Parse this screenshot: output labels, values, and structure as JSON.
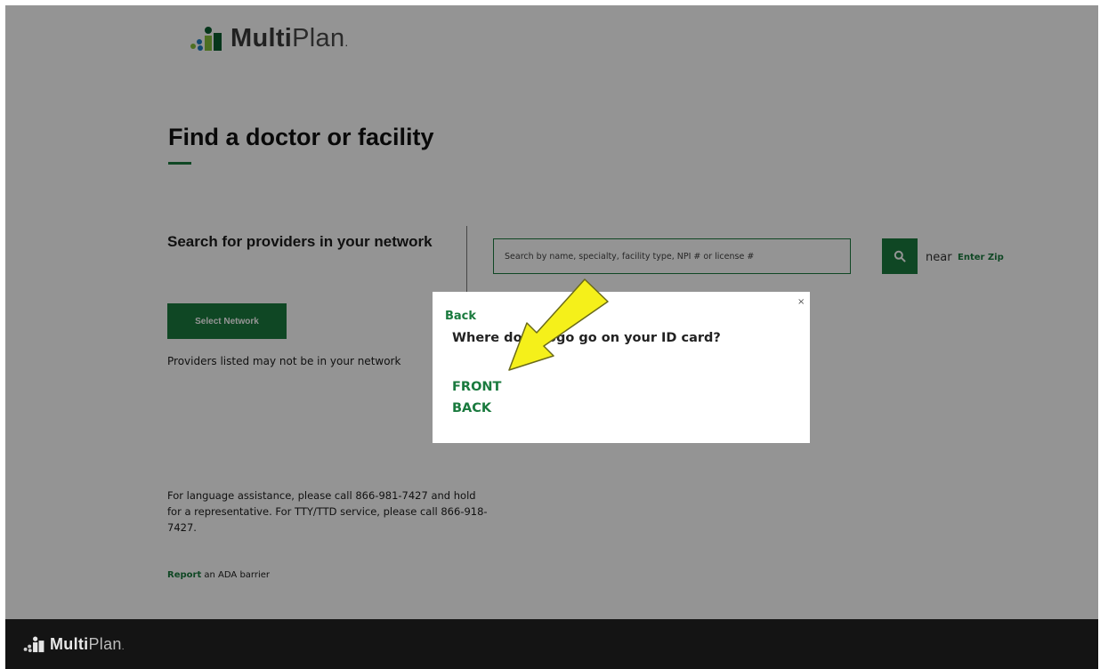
{
  "header": {
    "logo": {
      "word_bold": "Multi",
      "word_light": "Plan",
      "suffix": "."
    }
  },
  "page": {
    "title": "Find a doctor or facility"
  },
  "network": {
    "heading": "Search for providers in your network",
    "select_button": "Select Network",
    "note": "Providers listed may not be in your network"
  },
  "search": {
    "placeholder": "Search by name, specialty, facility type, NPI # or license #",
    "button_icon": "search-icon",
    "near_label": "near",
    "zip_link": "Enter Zip"
  },
  "assistance": {
    "text": "For language assistance, please call 866-981-7427 and hold for a representative. For TTY/TTD service, please call 866-918-7427.",
    "ada_link": "Report",
    "ada_text": " an ADA barrier"
  },
  "modal": {
    "close_label": "×",
    "back_label": "Back",
    "question": "Where does logo go on your ID card?",
    "options": [
      "FRONT",
      "BACK"
    ]
  },
  "annotation": {
    "arrow": "yellow-arrow-icon"
  },
  "footer": {
    "logo": {
      "word_bold": "Multi",
      "word_light": "Plan",
      "suffix": "."
    }
  },
  "colors": {
    "brand_green": "#1a7a3e",
    "logo_dark_green": "#0b5d2f",
    "logo_light_green": "#86bf3b",
    "logo_blue": "#1f7fc2",
    "arrow_yellow": "#f5f01a",
    "overlay": "rgba(0,0,0,0.42)",
    "footer_bg": "#141414"
  }
}
